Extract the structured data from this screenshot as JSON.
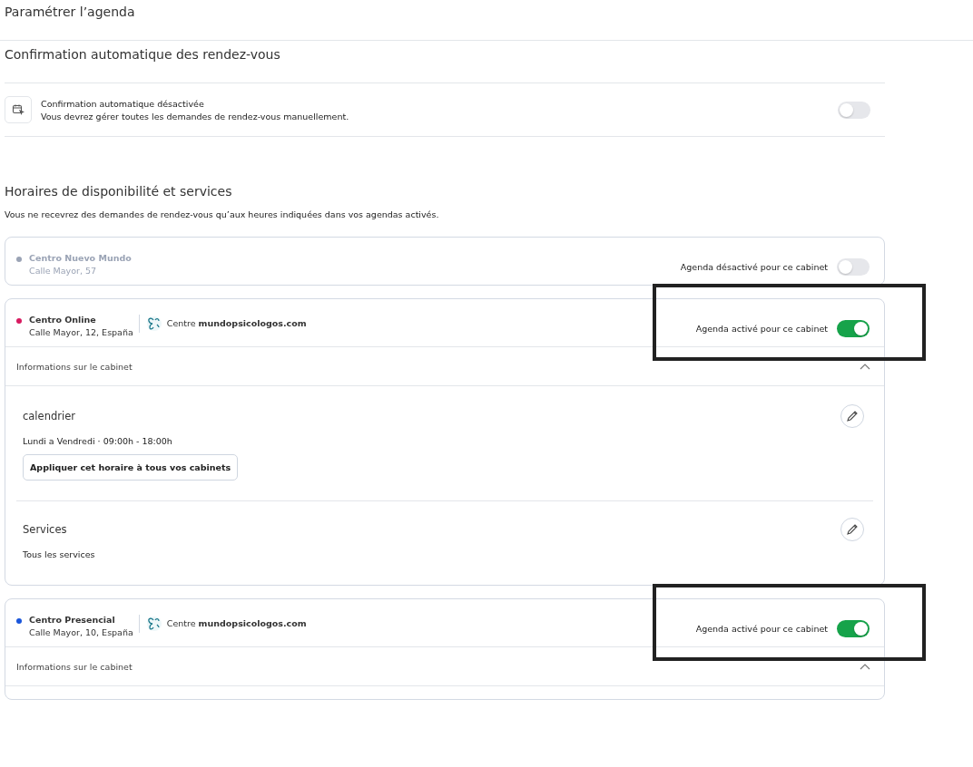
{
  "page_title": "Paramétrer l’agenda",
  "auto_confirmation": {
    "heading": "Confirmation automatique des rendez-vous",
    "title": "Confirmation automatique désactivée",
    "description": "Vous devrez gérer toutes les demandes de rendez-vous manuellement.",
    "on": false
  },
  "availability": {
    "heading": "Horaires de disponibilité et services",
    "description": "Vous ne recevrez des demandes de rendez-vous qu’aux heures indiquées dans vos agendas activés.",
    "clinics": [
      {
        "name": "Centro Nuevo Mundo",
        "address": "Calle Mayor, 57",
        "color": "#9aa3b5",
        "on": false,
        "toggle_label": "Agenda désactivé pour ce cabinet",
        "highlighted": false
      },
      {
        "name": "Centro Online",
        "address": "Calle Mayor, 12, España",
        "color": "#d81b60",
        "on": true,
        "platform": "Centre **mundopsicologos.com**",
        "toggle_label": "Agenda activé pour ce cabinet",
        "highlighted": true,
        "info_label": "Informations sur le cabinet",
        "expanded": true,
        "sections": [
          {
            "title": "calendrier",
            "detail": "Lundi a Vendredi ·  09:00h - 18:00h",
            "button": "Appliquer cet horaire à tous vos cabinets"
          },
          {
            "title": "Services",
            "detail": "Tous les services"
          }
        ]
      },
      {
        "name": "Centro Presencial",
        "address": "Calle Mayor, 10, España",
        "color": "#1a56db",
        "on": true,
        "platform": "Centre **mundopsicologos.com**",
        "toggle_label": "Agenda activé pour ce cabinet",
        "highlighted": true,
        "info_label": "Informations sur le cabinet",
        "expanded": true
      }
    ]
  }
}
